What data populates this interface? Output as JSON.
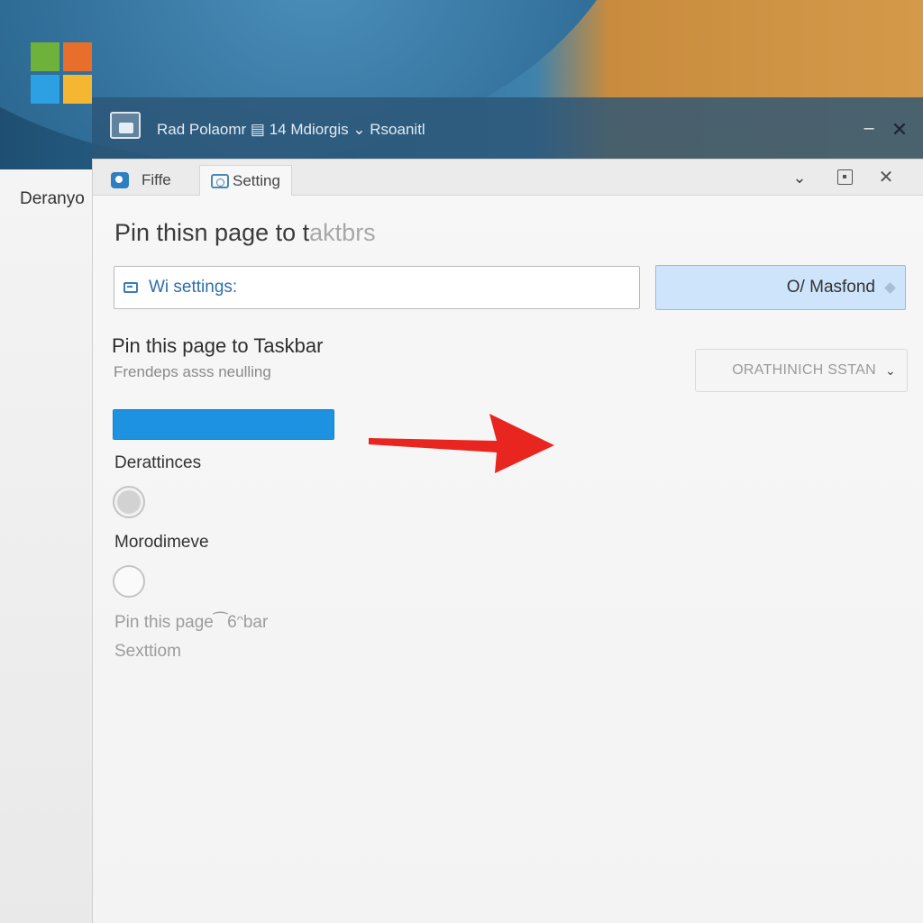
{
  "desktop": {
    "logo_icon": "windows-logo-icon"
  },
  "background_window": {
    "label": "Deranyo"
  },
  "outer_window": {
    "title": "Rad Polaomr ▤ 14 Mdiorgis ⌄ Rsoanitl",
    "app_icon": "window-app-icon",
    "minimize_symbol": "–",
    "close_symbol": "✕"
  },
  "main_window": {
    "tabs": [
      {
        "label": "Fiffe",
        "icon": "file-icon"
      },
      {
        "label": "Setting",
        "icon": "settings-tab-icon"
      }
    ],
    "controls": {
      "chevron_symbol": "⌄",
      "close_symbol": "✕"
    },
    "heading": "Pin thisn page to t",
    "heading_faded": "aktbrs",
    "search": {
      "value": "Wi settings:",
      "icon": "search-icon"
    },
    "action_button": {
      "label": "O/ Masfond"
    },
    "section": {
      "title": "Pin this page to Taskbar",
      "subtitle": "Frendeps asss neulling"
    },
    "dropdown": {
      "selected": "ORATHINICH SSTAN",
      "chevron_symbol": "⌄"
    },
    "progress": {
      "fraction": 1.0
    },
    "arrow": {
      "color": "#e8261f",
      "icon": "red-arrow-right-icon"
    },
    "options": [
      {
        "label": "Derattinces",
        "selected": true
      },
      {
        "label": "Morodimeve",
        "selected": false
      }
    ],
    "faded_lines": [
      "Pin this page⁀6ᵔbar",
      "Sexttiom"
    ]
  },
  "colors": {
    "accent": "#1d92e0",
    "accent_light": "#cde4fb",
    "arrow": "#e8261f"
  }
}
